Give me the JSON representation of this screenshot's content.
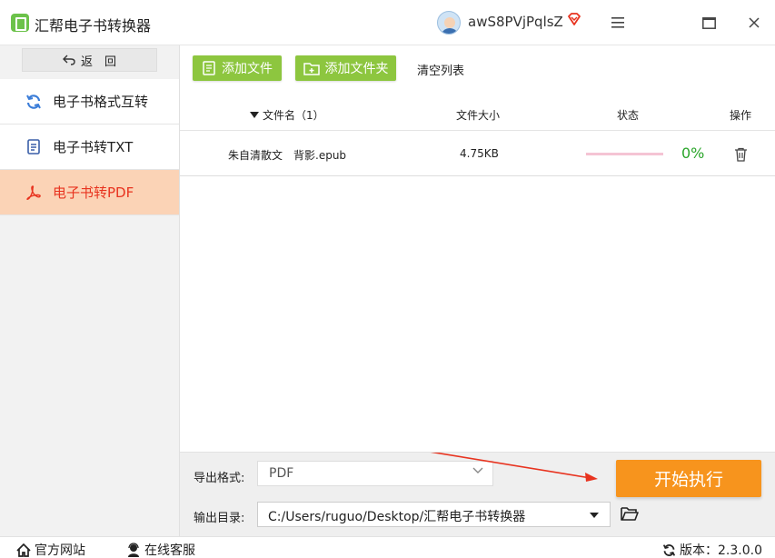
{
  "app": {
    "title": "汇帮电子书转换器",
    "username": "awS8PVjPqlsZ"
  },
  "sidebar": {
    "back_label": "返　回",
    "items": [
      {
        "label": "电子书格式互转",
        "icon": "refresh-icon",
        "active": false
      },
      {
        "label": "电子书转TXT",
        "icon": "document-icon",
        "active": false
      },
      {
        "label": "电子书转PDF",
        "icon": "pdf-icon",
        "active": true
      }
    ]
  },
  "toolbar": {
    "add_file": "添加文件",
    "add_folder": "添加文件夹",
    "clear_list": "清空列表"
  },
  "table": {
    "headers": {
      "name": "文件名（1）",
      "size": "文件大小",
      "status": "状态",
      "action": "操作"
    },
    "rows": [
      {
        "name": "朱自清散文　背影.epub",
        "size": "4.75KB",
        "progress": 0,
        "progress_text": "0%"
      }
    ]
  },
  "settings": {
    "format_label": "导出格式:",
    "format_value": "PDF",
    "dir_label": "输出目录:",
    "dir_value": "C:/Users/ruguo/Desktop/汇帮电子书转换器"
  },
  "actions": {
    "start": "开始执行"
  },
  "statusbar": {
    "website": "官方网站",
    "support": "在线客服",
    "version": "版本：2.3.0.0"
  },
  "colors": {
    "accent_green": "#8dc63f",
    "start_orange": "#f7941d",
    "active_nav_bg": "#fbd3b6",
    "active_nav_text": "#e8331f",
    "progress_green": "#2aa52a"
  }
}
